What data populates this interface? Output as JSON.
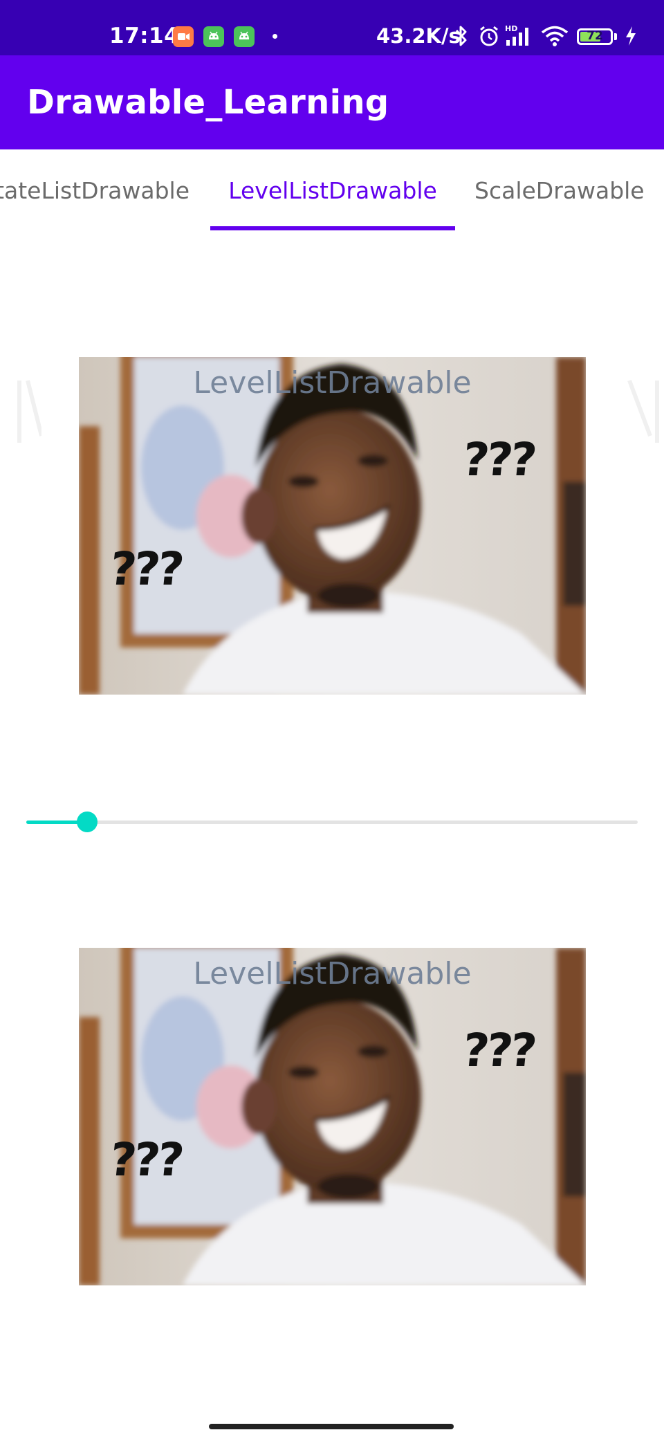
{
  "status_bar": {
    "time": "17:14",
    "net_speed": "43.2K/s",
    "battery_level": 72,
    "icons": [
      "video-app-icon",
      "android-app-icon",
      "android-app-icon",
      "dot-icon",
      "bluetooth-icon",
      "alarm-icon",
      "hd-signal-icon",
      "wifi-icon",
      "battery-icon",
      "charging-icon"
    ]
  },
  "app_bar": {
    "title": "Drawable_Learning"
  },
  "tabs": [
    {
      "label": "tateListDrawable",
      "selected": false
    },
    {
      "label": "LevelListDrawable",
      "selected": true
    },
    {
      "label": "ScaleDrawable",
      "selected": false
    }
  ],
  "images": [
    {
      "caption": "LevelListDrawable",
      "marks_left": "???",
      "marks_right": "???"
    },
    {
      "caption": "LevelListDrawable",
      "marks_left": "???",
      "marks_right": "???"
    }
  ],
  "slider": {
    "value_fraction": 0.1
  },
  "colors": {
    "status_bar": "#3700b3",
    "primary": "#6200ee",
    "accent": "#03dac5",
    "tab_inactive": "#6b6b6b"
  }
}
